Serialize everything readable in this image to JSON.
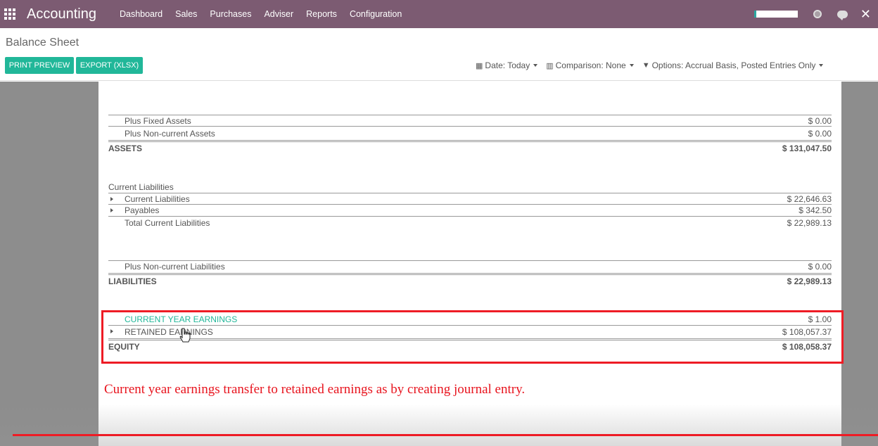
{
  "app": {
    "brand": "Accounting",
    "menu": [
      "Dashboard",
      "Sales",
      "Purchases",
      "Adviser",
      "Reports",
      "Configuration"
    ],
    "close_glyph": "✕",
    "accent_color": "#7c5b72"
  },
  "page": {
    "title": "Balance Sheet",
    "print_label": "PRINT PREVIEW",
    "export_label": "EXPORT (XLSX)",
    "filters": {
      "date": "Date: Today",
      "comparison": "Comparison: None",
      "options": "Options: Accrual Basis, Posted Entries Only"
    }
  },
  "report": {
    "plus_fixed_assets": {
      "label": "Plus Fixed Assets",
      "amount": "$ 0.00"
    },
    "plus_noncurrent_assets": {
      "label": "Plus Non-current Assets",
      "amount": "$ 0.00"
    },
    "assets": {
      "label": "ASSETS",
      "amount": "$ 131,047.50"
    },
    "current_liabilities_header": "Current Liabilities",
    "current_liabilities": {
      "label": "Current Liabilities",
      "amount": "$ 22,646.63"
    },
    "payables": {
      "label": "Payables",
      "amount": "$ 342.50"
    },
    "total_current_liabilities": {
      "label": "Total Current Liabilities",
      "amount": "$ 22,989.13"
    },
    "plus_noncurrent_liabilities": {
      "label": "Plus Non-current Liabilities",
      "amount": "$ 0.00"
    },
    "liabilities": {
      "label": "LIABILITIES",
      "amount": "$ 22,989.13"
    },
    "current_year_earnings": {
      "label": "CURRENT YEAR EARNINGS",
      "amount": "$ 1.00"
    },
    "retained_earnings": {
      "label": "RETAINED EARNINGS",
      "amount": "$ 108,057.37"
    },
    "equity": {
      "label": "EQUITY",
      "amount": "$ 108,058.37"
    }
  },
  "annotation": "Current year earnings transfer to retained earnings as by creating journal entry."
}
